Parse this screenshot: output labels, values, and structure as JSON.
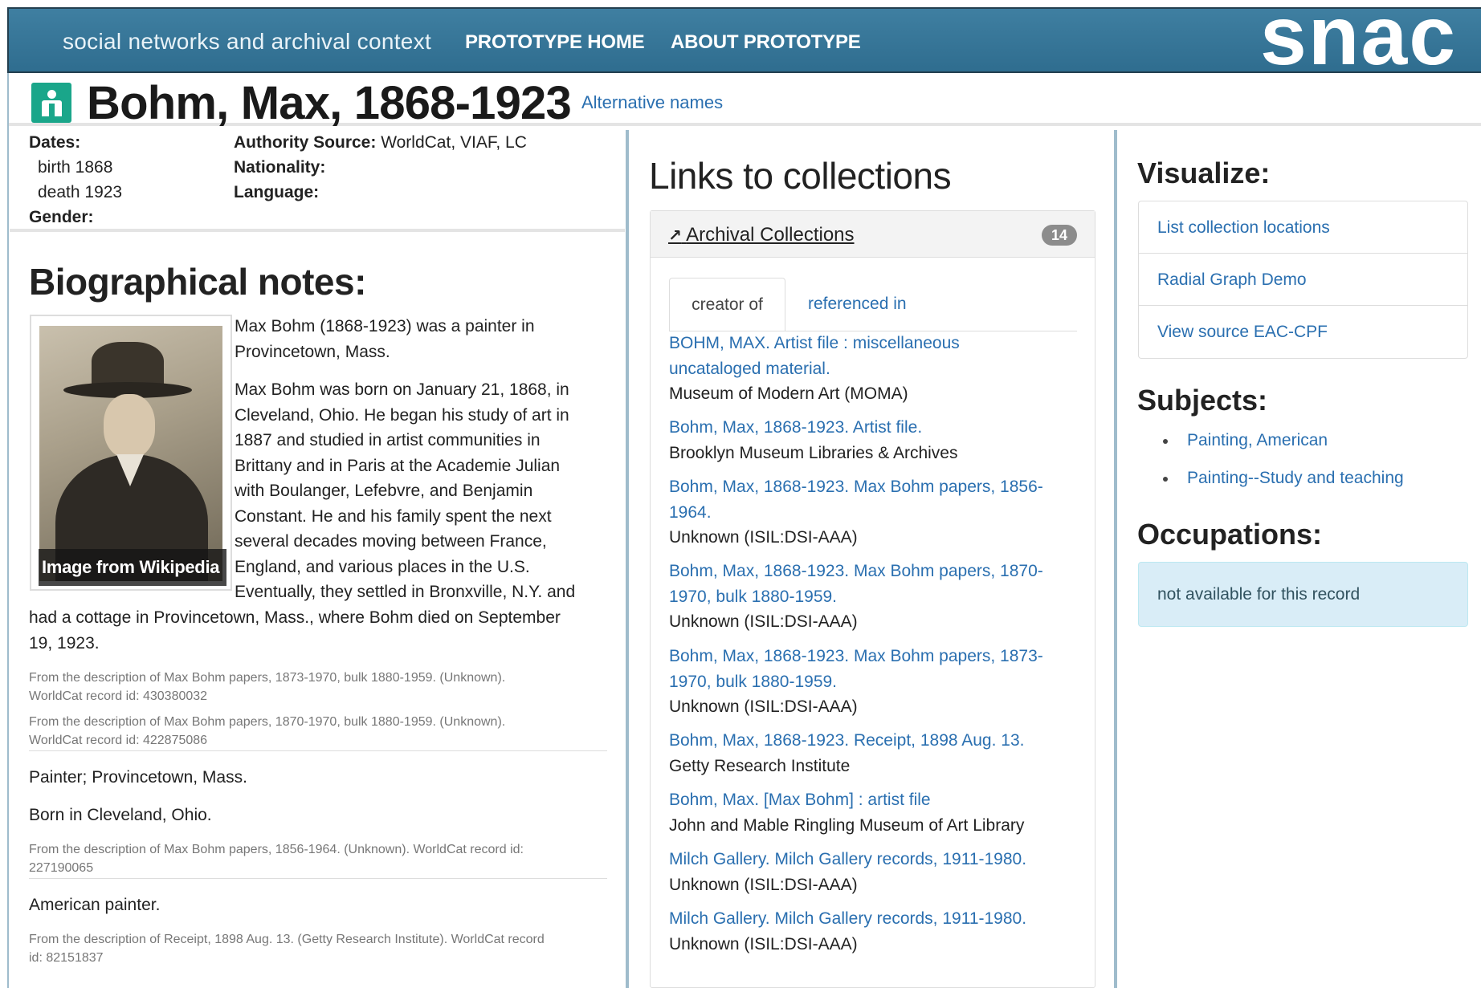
{
  "nav": {
    "brand": "social networks and archival context",
    "links": [
      "PROTOTYPE HOME",
      "ABOUT PROTOTYPE"
    ],
    "logo": "snac"
  },
  "header": {
    "title": "Bohm, Max, 1868-1923",
    "alt_names": "Alternative names",
    "icon": "person-icon",
    "icon_color": "#1aa68a"
  },
  "meta": {
    "dates_label": "Dates:",
    "birth": "birth 1868",
    "death": "death 1923",
    "gender_label": "Gender:",
    "authority_label": "Authority Source:",
    "authority_value": "WorldCat, VIAF, LC",
    "nationality_label": "Nationality:",
    "language_label": "Language:"
  },
  "bio": {
    "heading": "Biographical notes:",
    "image_caption": "Image from Wikipedia",
    "p1": [
      "Max Bohm (1868-1923) was a painter in",
      "Provincetown, Mass."
    ],
    "p2": [
      "Max Bohm was born on January 21, 1868, in",
      "Cleveland, Ohio. He began his study of art in",
      "1887 and studied in artist communities in",
      "Brittany and in Paris at the Academie Julian",
      "with Boulanger, Lefebvre, and Benjamin",
      "Constant. He and his family spent the next",
      "several decades moving between France,",
      "England, and various places in the U.S.",
      "Eventually, they settled in Bronxville, N.Y. and",
      "had a cottage in Provincetown, Mass., where Bohm died on September",
      "19, 1923."
    ],
    "src1": [
      "From the description of Max Bohm papers, 1873-1970, bulk 1880-1959. (Unknown).",
      "WorldCat record id: 430380032"
    ],
    "src2": [
      "From the description of Max Bohm papers, 1870-1970, bulk 1880-1959. (Unknown).",
      "WorldCat record id: 422875086"
    ],
    "note1": "Painter; Provincetown, Mass.",
    "note2": "Born in Cleveland, Ohio.",
    "src3": [
      "From the description of Max Bohm papers, 1856-1964. (Unknown). WorldCat record id:",
      "227190065"
    ],
    "note3": "American painter.",
    "src4": [
      "From the description of Receipt, 1898 Aug. 13. (Getty Research Institute). WorldCat record",
      "id: 82151837"
    ]
  },
  "links": {
    "heading": "Links to collections",
    "panel_title": "Archival Collections",
    "count": "14",
    "tabs": [
      "creator of",
      "referenced in"
    ],
    "items": [
      {
        "title": [
          "BOHM, MAX. Artist file : miscellaneous",
          "uncataloged material."
        ],
        "repo": "Museum of Modern Art (MOMA)"
      },
      {
        "title": [
          "Bohm, Max, 1868-1923. Artist file."
        ],
        "repo": "Brooklyn Museum Libraries & Archives"
      },
      {
        "title": [
          "Bohm, Max, 1868-1923. Max Bohm papers, 1856-",
          "1964."
        ],
        "repo": "Unknown (ISIL:DSI-AAA)"
      },
      {
        "title": [
          "Bohm, Max, 1868-1923. Max Bohm papers, 1870-",
          "1970, bulk 1880-1959."
        ],
        "repo": "Unknown (ISIL:DSI-AAA)"
      },
      {
        "title": [
          "Bohm, Max, 1868-1923. Max Bohm papers, 1873-",
          "1970, bulk 1880-1959."
        ],
        "repo": "Unknown (ISIL:DSI-AAA)"
      },
      {
        "title": [
          "Bohm, Max, 1868-1923. Receipt, 1898 Aug. 13."
        ],
        "repo": "Getty Research Institute"
      },
      {
        "title": [
          "Bohm, Max. [Max Bohm] : artist file"
        ],
        "repo": "John and Mable Ringling Museum of Art Library"
      },
      {
        "title": [
          "Milch Gallery. Milch Gallery records, 1911-1980."
        ],
        "repo": "Unknown (ISIL:DSI-AAA)"
      },
      {
        "title": [
          "Milch Gallery. Milch Gallery records, 1911-1980."
        ],
        "repo": "Unknown (ISIL:DSI-AAA)"
      }
    ]
  },
  "visualize": {
    "heading": "Visualize:",
    "items": [
      "List collection locations",
      "Radial Graph Demo",
      "View source EAC-CPF"
    ]
  },
  "subjects": {
    "heading": "Subjects:",
    "items": [
      "Painting, American",
      "Painting--Study and teaching"
    ]
  },
  "occupations": {
    "heading": "Occupations:",
    "empty": "not available for this record"
  },
  "colors": {
    "nav_bg": "#3a7899",
    "link": "#2a6fb0",
    "alert_bg": "#d9edf7"
  }
}
